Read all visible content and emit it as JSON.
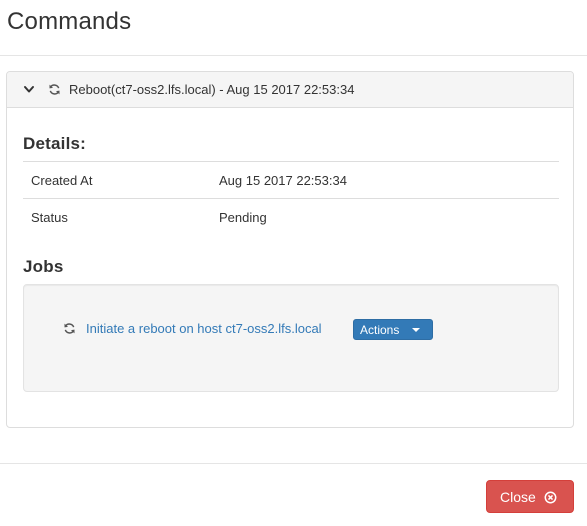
{
  "modal": {
    "title": "Commands"
  },
  "command": {
    "heading": "Reboot(ct7-oss2.lfs.local) - Aug 15 2017 22:53:34",
    "details_title": "Details:",
    "details": [
      {
        "label": "Created At",
        "value": "Aug 15 2017 22:53:34"
      },
      {
        "label": "Status",
        "value": "Pending"
      }
    ],
    "jobs_title": "Jobs",
    "jobs": [
      {
        "label": "Initiate a reboot on host ct7-oss2.lfs.local",
        "actions_label": "Actions"
      }
    ]
  },
  "footer": {
    "close_label": "Close"
  },
  "icons": {
    "chevron": "chevron-down-icon",
    "spinner": "refresh-icon",
    "caret": "caret-down-icon",
    "close": "times-circle-icon"
  },
  "colors": {
    "link": "#337ab7",
    "primary": "#337ab7",
    "danger": "#d9534f",
    "panel_heading_bg": "#f5f5f5"
  }
}
